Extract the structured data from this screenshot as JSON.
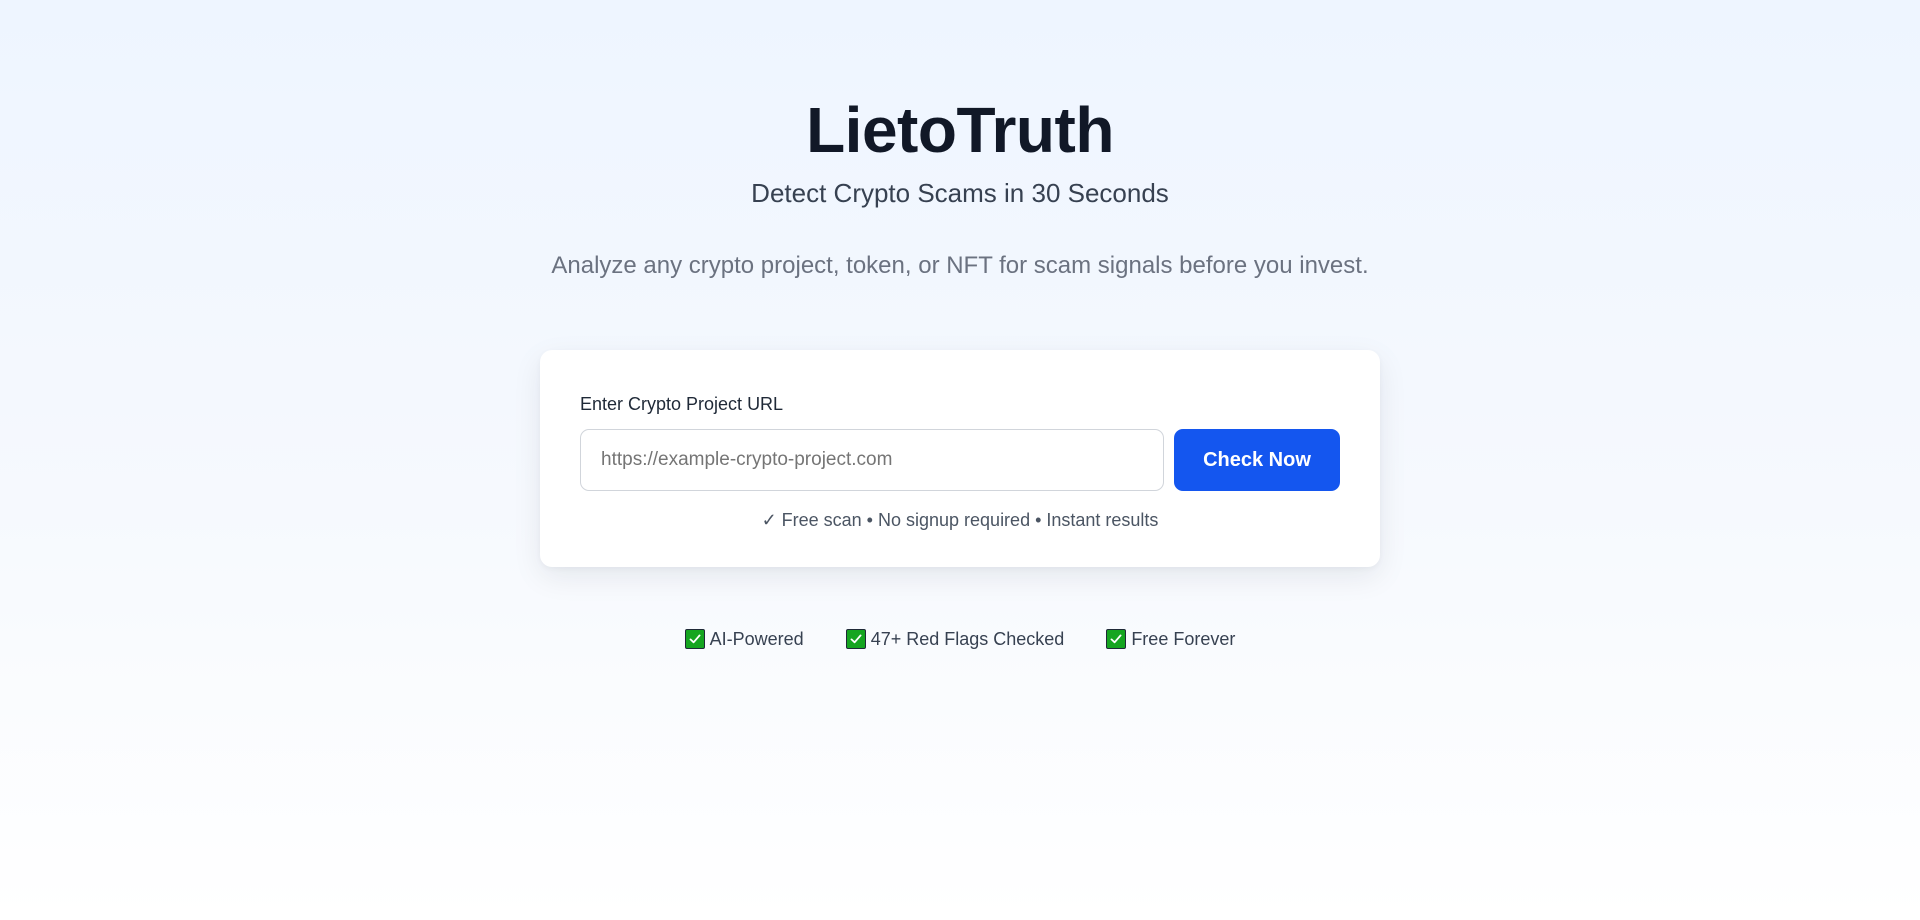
{
  "hero": {
    "title": "LietoTruth",
    "subtitle": "Detect Crypto Scams in 30 Seconds",
    "description": "Analyze any crypto project, token, or NFT for scam signals before you invest."
  },
  "form": {
    "label": "Enter Crypto Project URL",
    "input_placeholder": "https://example-crypto-project.com",
    "input_value": "",
    "button_label": "Check Now",
    "note": "✓ Free scan • No signup required • Instant results"
  },
  "features": [
    {
      "icon": "check-box-icon",
      "label": "AI-Powered"
    },
    {
      "icon": "check-box-icon",
      "label": "47+ Red Flags Checked"
    },
    {
      "icon": "check-box-icon",
      "label": "Free Forever"
    }
  ],
  "colors": {
    "accent": "#1456ef",
    "check_green": "#15a520",
    "title": "#111827"
  }
}
